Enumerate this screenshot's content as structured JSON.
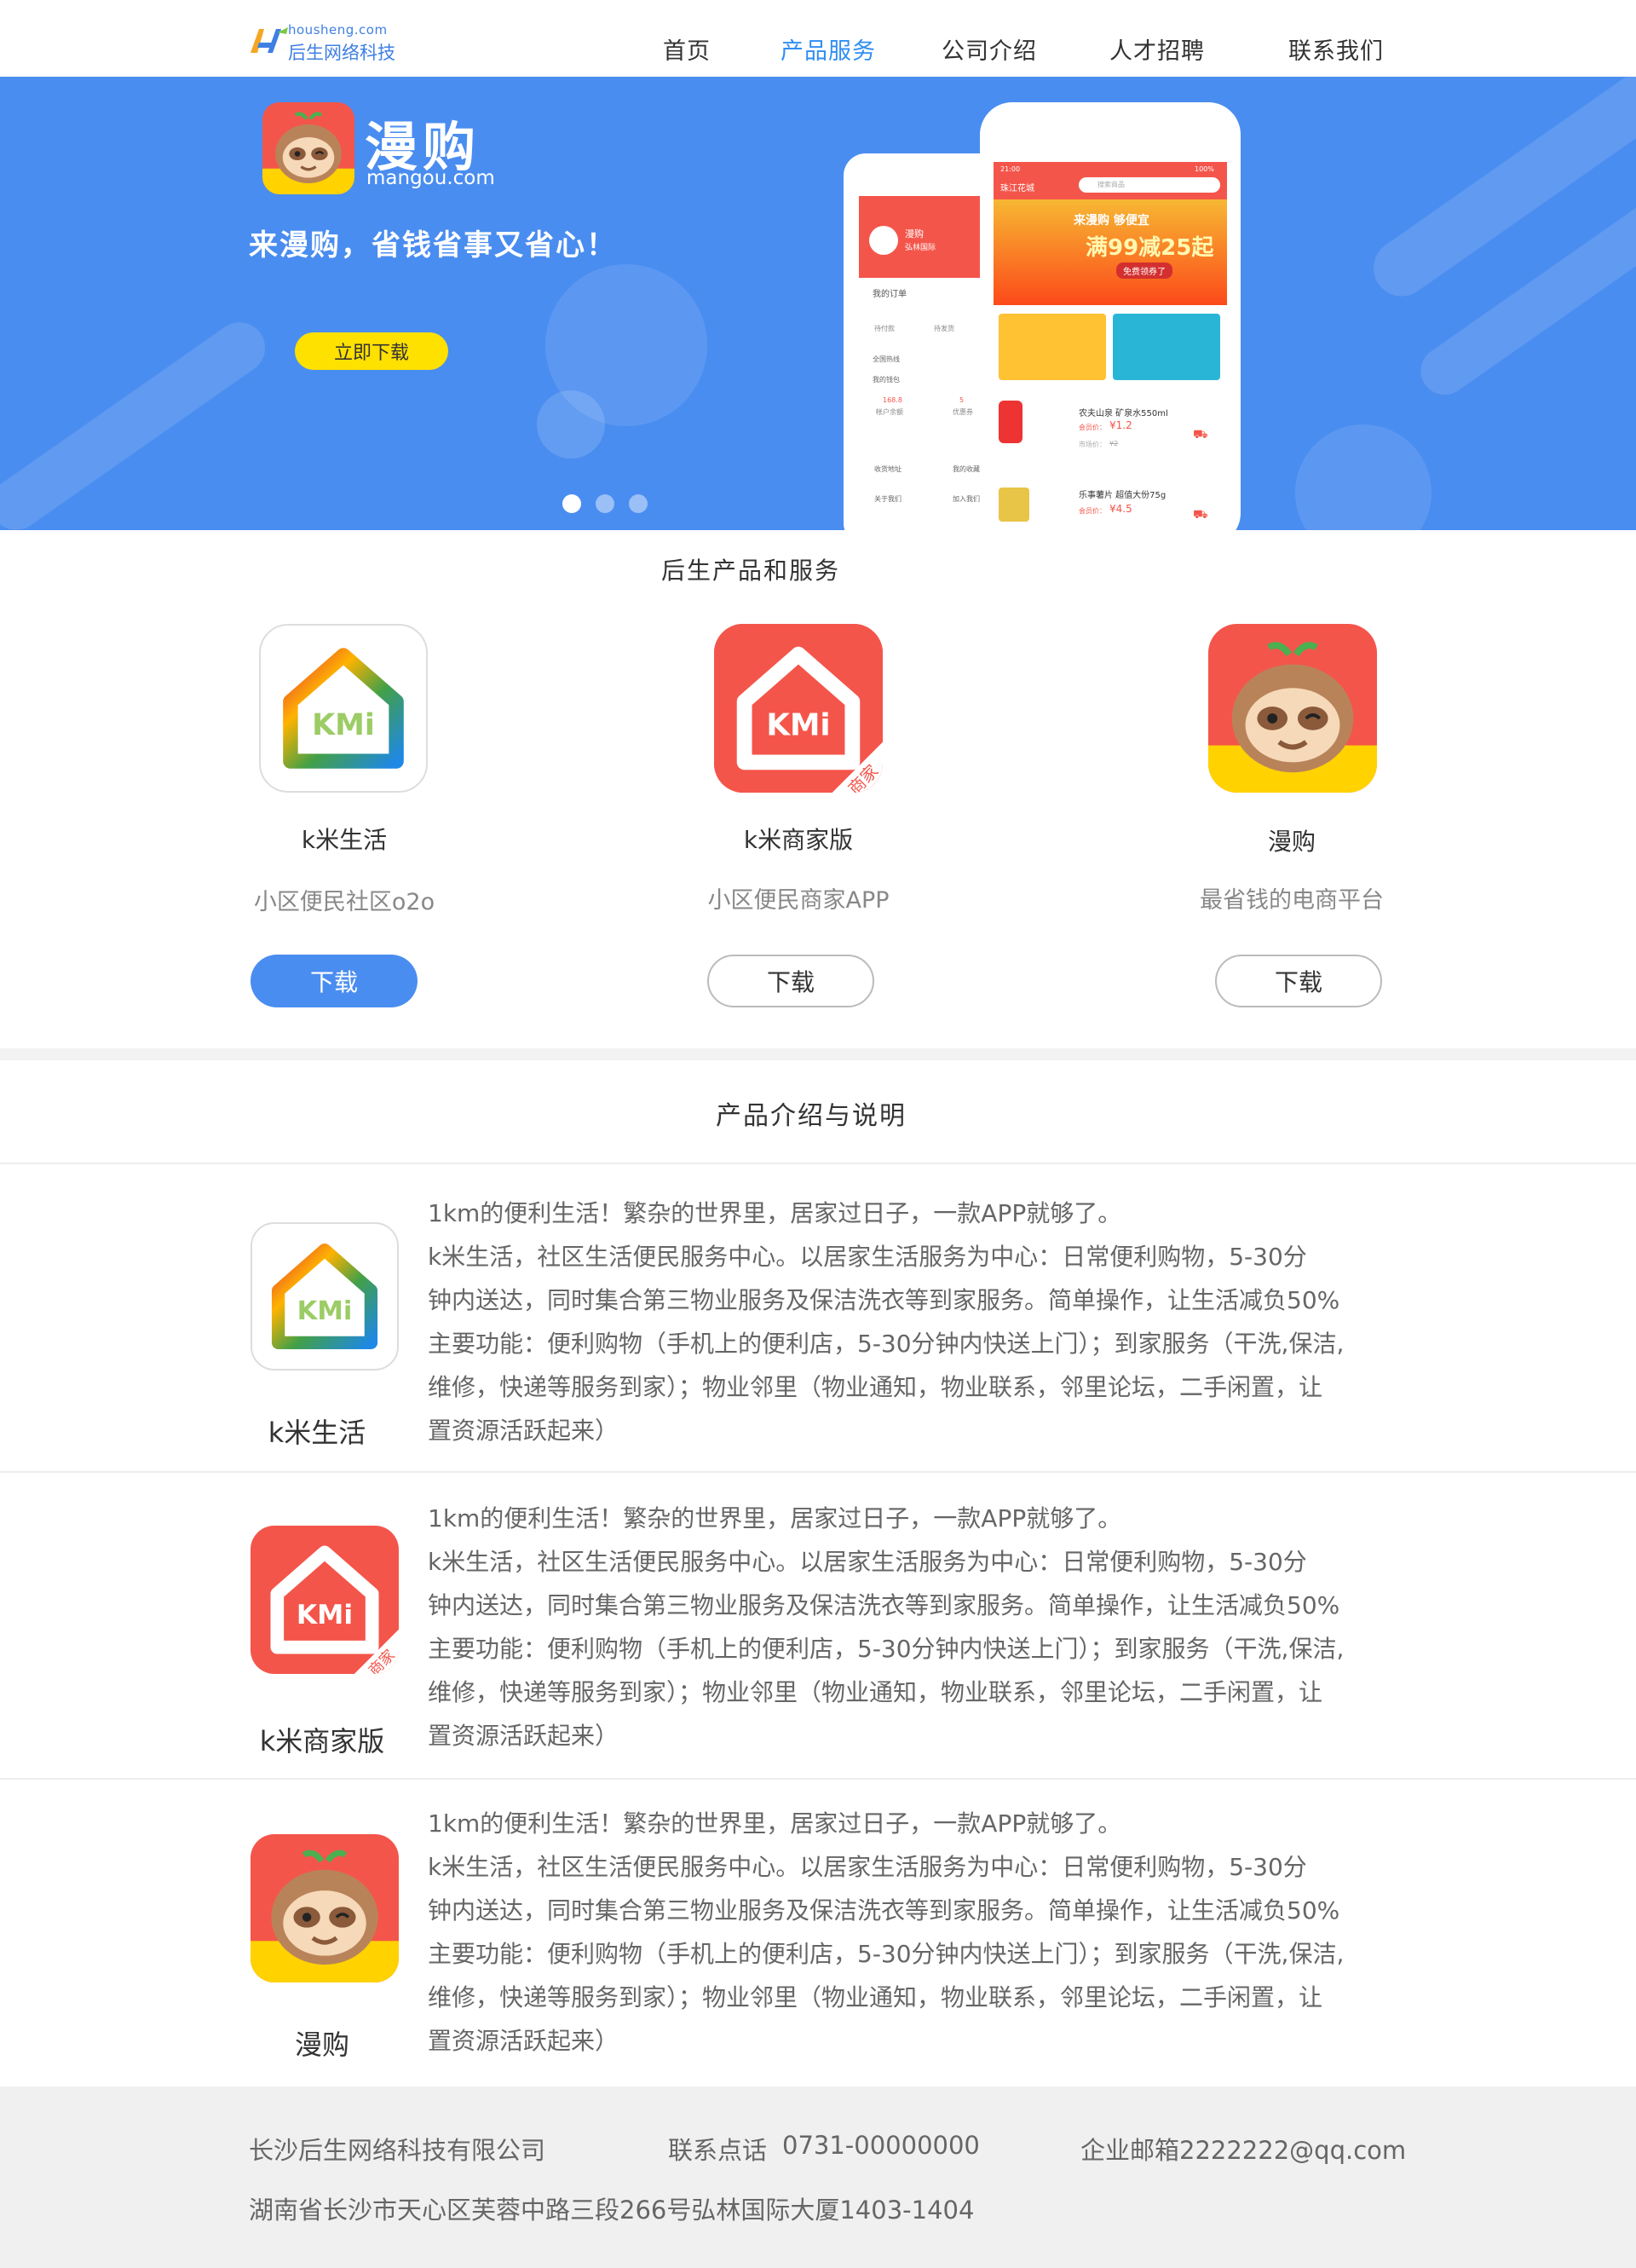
{
  "brand": {
    "logo_domain": "housheng.com",
    "logo_name": "后生网络科技"
  },
  "nav": {
    "items": [
      {
        "label": "首页"
      },
      {
        "label": "产品服务"
      },
      {
        "label": "公司介绍"
      },
      {
        "label": "人才招聘"
      },
      {
        "label": "联系我们"
      }
    ],
    "active_index": 1
  },
  "banner": {
    "app_name": "漫购",
    "app_url": "mangou.com",
    "slogan": "来漫购，省钱省事又省心！",
    "download_label": "立即下载",
    "slide_count": 3,
    "active_slide": 0,
    "mock_screen": {
      "location": "珠江花城",
      "search_placeholder": "搜索商品",
      "promo_title": "来漫购 够便宜",
      "promo_deal": "满99减25起",
      "promo_sub": "免费领券了",
      "time": "21:00",
      "battery": "100%",
      "items": [
        {
          "name": "农夫山泉 矿泉水550ml",
          "price_label": "会员价：",
          "price": "¥1.2",
          "market_label": "市场价：",
          "market_price": "¥2"
        },
        {
          "name": "乐事薯片 超值大份75g",
          "price_label": "会员价：",
          "price": "¥4.5"
        }
      ],
      "back_screen": {
        "title": "漫购",
        "subtitle": "弘林国际",
        "orders": "我的订单",
        "order_states": [
          "待付款",
          "待发货"
        ],
        "menu": [
          "全国热线",
          "我的钱包"
        ],
        "balance": "168.8",
        "balance_label": "帐户余额",
        "coupon_count": "5",
        "coupon_label": "优惠券",
        "bottom_items": [
          "收货地址",
          "我的收藏",
          "关于我们",
          "加入我们"
        ]
      }
    }
  },
  "products": {
    "title": "后生产品和服务",
    "items": [
      {
        "name": "k米生活",
        "desc": "小区便民社区o2o",
        "button": "下载",
        "style": "solid"
      },
      {
        "name": "k米商家版",
        "desc": "小区便民商家APP",
        "button": "下载",
        "style": "outline"
      },
      {
        "name": "漫购",
        "desc": "最省钱的电商平台",
        "button": "下载",
        "style": "outline"
      }
    ]
  },
  "intro": {
    "title": "产品介绍与说明",
    "rows": [
      {
        "name": "k米生活",
        "lines": [
          "1km的便利生活！繁杂的世界里，居家过日子，一款APP就够了。",
          "k米生活，社区生活便民服务中心。以居家生活服务为中心：日常便利购物，5-30分",
          "钟内送达，同时集合第三物业服务及保洁洗衣等到家服务。简单操作，让生活减负50%",
          "主要功能：便利购物（手机上的便利店，5-30分钟内快送上门）；到家服务（干洗,保洁,",
          "维修，快递等服务到家）；物业邻里（物业通知，物业联系，邻里论坛，二手闲置，让",
          "置资源活跃起来）"
        ]
      },
      {
        "name": "k米商家版",
        "lines": [
          "1km的便利生活！繁杂的世界里，居家过日子，一款APP就够了。",
          "k米生活，社区生活便民服务中心。以居家生活服务为中心：日常便利购物，5-30分",
          "钟内送达，同时集合第三物业服务及保洁洗衣等到家服务。简单操作，让生活减负50%",
          "主要功能：便利购物（手机上的便利店，5-30分钟内快送上门）；到家服务（干洗,保洁,",
          "维修，快递等服务到家）；物业邻里（物业通知，物业联系，邻里论坛，二手闲置，让",
          "置资源活跃起来）"
        ]
      },
      {
        "name": "漫购",
        "lines": [
          "1km的便利生活！繁杂的世界里，居家过日子，一款APP就够了。",
          "k米生活，社区生活便民服务中心。以居家生活服务为中心：日常便利购物，5-30分",
          "钟内送达，同时集合第三物业服务及保洁洗衣等到家服务。简单操作，让生活减负50%",
          "主要功能：便利购物（手机上的便利店，5-30分钟内快送上门）；到家服务（干洗,保洁,",
          "维修，快递等服务到家）；物业邻里（物业通知，物业联系，邻里论坛，二手闲置，让",
          "置资源活跃起来）"
        ]
      }
    ]
  },
  "footer": {
    "company": "长沙后生网络科技有限公司",
    "phone_label": "联系点话",
    "phone": "0731-00000000",
    "email": "企业邮箱2222222@qq.com",
    "address": "湖南省长沙市天心区芙蓉中路三段266号弘林国际大厦1403-1404"
  },
  "colors": {
    "primary": "#4a8df0",
    "nav_active": "#2f8ef2",
    "download_yellow": "#ffe100",
    "kmi_red": "#f4554a",
    "mangou_yellow": "#ffd200",
    "footer_bg": "#f0f0f0"
  }
}
